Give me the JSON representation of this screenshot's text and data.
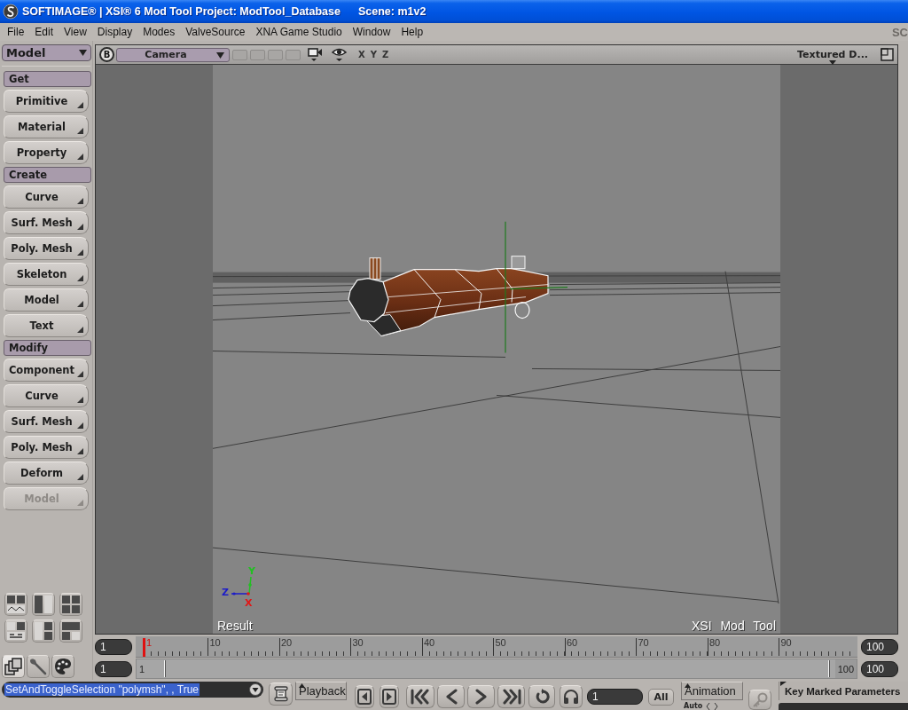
{
  "window": {
    "title": "SOFTIMAGE® | XSI® 6 Mod Tool Project: ModTool_Database",
    "scene": "Scene: m1v2"
  },
  "menu_bar": {
    "items": [
      "File",
      "Edit",
      "View",
      "Display",
      "Modes",
      "ValveSource",
      "XNA Game Studio",
      "Window",
      "Help"
    ],
    "edge_text": "SC"
  },
  "toolbox": {
    "mode": "Model",
    "sections": [
      {
        "title": "Get",
        "items": [
          {
            "label": "Primitive",
            "disabled": false
          },
          {
            "label": "Material",
            "disabled": false
          },
          {
            "label": "Property",
            "disabled": false
          }
        ]
      },
      {
        "title": "Create",
        "items": [
          {
            "label": "Curve",
            "disabled": false
          },
          {
            "label": "Surf. Mesh",
            "disabled": false
          },
          {
            "label": "Poly. Mesh",
            "disabled": false
          },
          {
            "label": "Skeleton",
            "disabled": false
          },
          {
            "label": "Model",
            "disabled": false
          },
          {
            "label": "Text",
            "disabled": false
          }
        ]
      },
      {
        "title": "Modify",
        "items": [
          {
            "label": "Component",
            "disabled": false
          },
          {
            "label": "Curve",
            "disabled": false
          },
          {
            "label": "Surf. Mesh",
            "disabled": false
          },
          {
            "label": "Poly. Mesh",
            "disabled": false
          },
          {
            "label": "Deform",
            "disabled": false
          },
          {
            "label": "Model",
            "disabled": true
          }
        ]
      }
    ]
  },
  "panel_tabs": [
    {
      "kind": "model",
      "selected": true
    },
    {
      "kind": "tool",
      "selected": false
    },
    {
      "kind": "palette",
      "selected": false
    }
  ],
  "viewport": {
    "buffer": "B",
    "camera": "Camera",
    "axes": [
      "X",
      "Y",
      "Z"
    ],
    "display_mode": "Textured D...",
    "gizmo": [
      {
        "label": "Y",
        "color": "#22c022"
      },
      {
        "label": "Z",
        "color": "#1c1cc8"
      },
      {
        "label": "X",
        "color": "#e01818"
      }
    ],
    "label_left": "Result",
    "label_right": "XSI Mod Tool"
  },
  "timeline": {
    "start": "1",
    "end": "100",
    "playhead": {
      "label": "1",
      "level": 0
    },
    "ticks": [
      "10",
      "20",
      "30",
      "40",
      "50",
      "60",
      "70",
      "80",
      "90"
    ]
  },
  "range": {
    "start": "1",
    "end": "100",
    "start_label": "1",
    "end_label": "100",
    "in_thumb": {
      "level": 0.038
    },
    "out_thumb": {
      "level": 0.96
    }
  },
  "command_line": {
    "value": "SetAndToggleSelection \"polymsh\", , True",
    "highlighted": true
  },
  "transport": {
    "playback": "Playback",
    "frame": "1",
    "scope": "All"
  },
  "animation": {
    "label": "Animation",
    "auto": "Auto"
  },
  "key_button": {
    "disabled": true
  },
  "key_panel": {
    "label": "Key Marked Parameters"
  }
}
